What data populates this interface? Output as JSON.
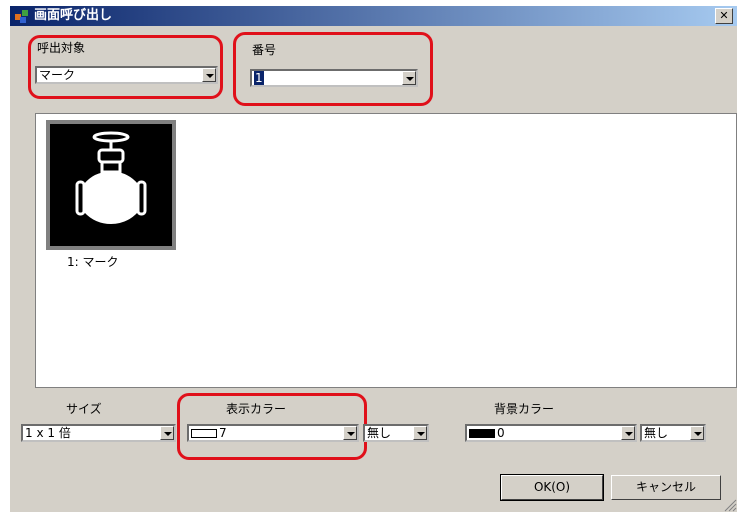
{
  "window": {
    "title": "画面呼び出し",
    "close_label": "✕"
  },
  "call_target": {
    "label": "呼出対象",
    "value": "マーク"
  },
  "number": {
    "label": "番号",
    "value": "1"
  },
  "preview": {
    "items": [
      {
        "caption": "1: マーク"
      }
    ]
  },
  "size": {
    "label": "サイズ",
    "value": "1 x 1 倍"
  },
  "display_color": {
    "label": "表示カラー",
    "value": "7",
    "swatch_color": "#ffffff",
    "blink_value": "無し"
  },
  "bg_color": {
    "label": "背景カラー",
    "value": "0",
    "swatch_color": "#000000",
    "blink_value": "無し"
  },
  "buttons": {
    "ok": "OK(O)",
    "cancel": "キャンセル"
  },
  "colors": {
    "highlight": "#e0101a",
    "title_start": "#0a246a",
    "title_end": "#a6caf0"
  }
}
